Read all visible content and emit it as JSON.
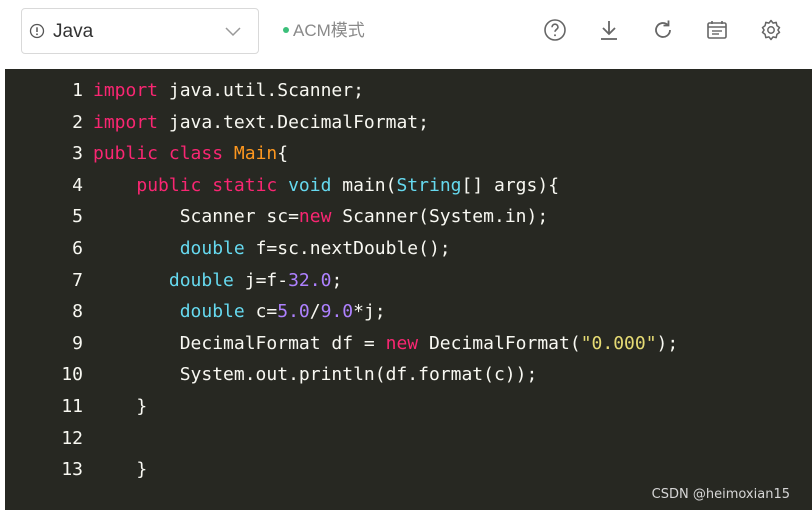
{
  "toolbar": {
    "language": "Java",
    "mode": "ACM模式",
    "icons": [
      "help-icon",
      "download-icon",
      "refresh-icon",
      "console-icon",
      "settings-icon"
    ]
  },
  "editor": {
    "theme_background": "#272822",
    "lines": [
      {
        "n": "1",
        "tokens": [
          [
            "kw",
            "import"
          ],
          [
            "t",
            " java.util.Scanner;"
          ]
        ]
      },
      {
        "n": "2",
        "tokens": [
          [
            "kw",
            "import"
          ],
          [
            "t",
            " java.text.DecimalFormat;"
          ]
        ]
      },
      {
        "n": "3",
        "tokens": [
          [
            "kw",
            "public class "
          ],
          [
            "cls",
            "Main"
          ],
          [
            "t",
            "{"
          ]
        ]
      },
      {
        "n": "4",
        "tokens": [
          [
            "t",
            "    "
          ],
          [
            "kw",
            "public static "
          ],
          [
            "ty",
            "void"
          ],
          [
            "t",
            " main("
          ],
          [
            "ty",
            "String"
          ],
          [
            "t",
            "[] args){"
          ]
        ]
      },
      {
        "n": "5",
        "tokens": [
          [
            "t",
            "        Scanner sc="
          ],
          [
            "kw",
            "new"
          ],
          [
            "t",
            " Scanner(System.in);"
          ]
        ]
      },
      {
        "n": "6",
        "tokens": [
          [
            "t",
            "        "
          ],
          [
            "ty",
            "double"
          ],
          [
            "t",
            " f=sc.nextDouble();"
          ]
        ]
      },
      {
        "n": "7",
        "tokens": [
          [
            "t",
            "       "
          ],
          [
            "ty",
            "double"
          ],
          [
            "t",
            " j=f-"
          ],
          [
            "num",
            "32.0"
          ],
          [
            "t",
            ";"
          ]
        ]
      },
      {
        "n": "8",
        "tokens": [
          [
            "t",
            "        "
          ],
          [
            "ty",
            "double"
          ],
          [
            "t",
            " c="
          ],
          [
            "num",
            "5.0"
          ],
          [
            "t",
            "/"
          ],
          [
            "num",
            "9.0"
          ],
          [
            "t",
            "*j;"
          ]
        ]
      },
      {
        "n": "9",
        "tokens": [
          [
            "t",
            "        DecimalFormat df = "
          ],
          [
            "kw",
            "new"
          ],
          [
            "t",
            " DecimalFormat("
          ],
          [
            "str",
            "\"0.000\""
          ],
          [
            "t",
            ");"
          ]
        ]
      },
      {
        "n": "10",
        "tokens": [
          [
            "t",
            "        System.out.println(df.format(c));"
          ]
        ]
      },
      {
        "n": "11",
        "tokens": [
          [
            "t",
            "    }"
          ]
        ]
      },
      {
        "n": "12",
        "tokens": []
      },
      {
        "n": "13",
        "tokens": [
          [
            "t",
            "    }"
          ]
        ]
      }
    ]
  },
  "watermark": "CSDN @heimoxian15"
}
